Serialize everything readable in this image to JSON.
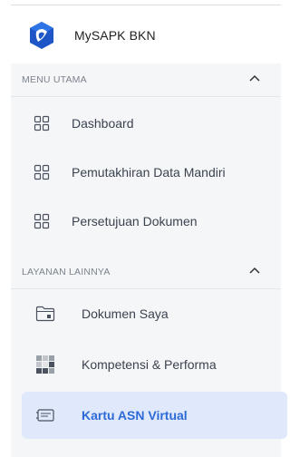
{
  "app": {
    "name": "MySAPK BKN"
  },
  "sections": [
    {
      "title": "MENU UTAMA",
      "items": [
        {
          "label": "Dashboard",
          "icon": "grid-icon"
        },
        {
          "label": "Pemutakhiran Data Mandiri",
          "icon": "grid-icon"
        },
        {
          "label": "Persetujuan Dokumen",
          "icon": "grid-icon"
        }
      ]
    },
    {
      "title": "LAYANAN LAINNYA",
      "items": [
        {
          "label": "Dokumen Saya",
          "icon": "folder-icon"
        },
        {
          "label": "Kompetensi & Performa",
          "icon": "blocks-icon"
        },
        {
          "label": "Kartu ASN Virtual",
          "icon": "card-icon",
          "active": true
        }
      ]
    }
  ],
  "colors": {
    "active_bg": "#dfe9fb",
    "active_text": "#2d6ad8",
    "brand_blue": "#1e56c8"
  }
}
